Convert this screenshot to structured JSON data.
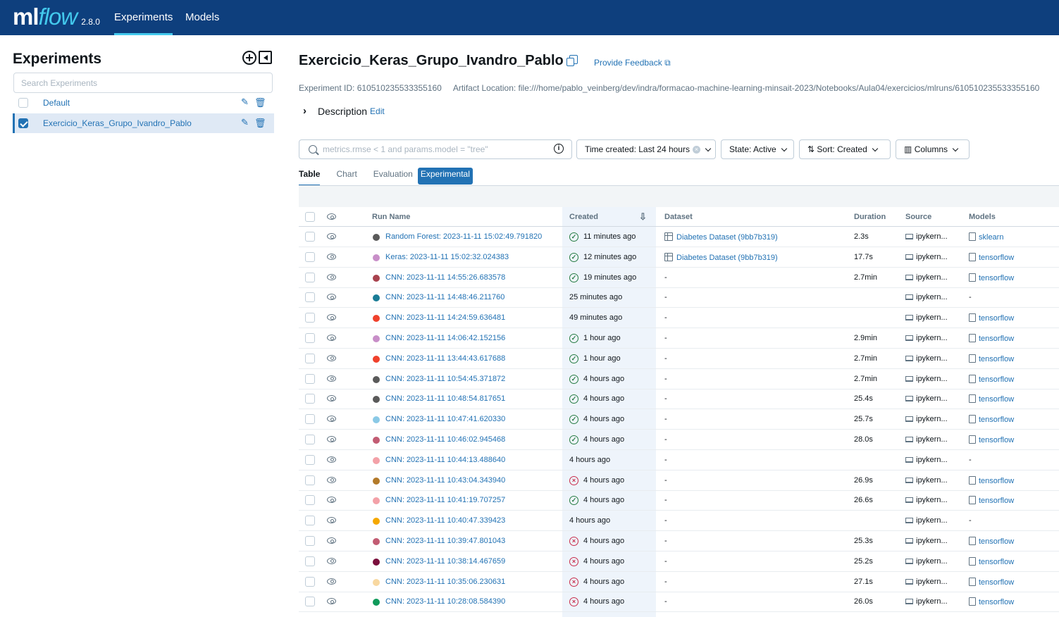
{
  "app": {
    "logo_ml": "ml",
    "logo_flow": "flow",
    "version": "2.8.0"
  },
  "nav": {
    "experiments": "Experiments",
    "models": "Models"
  },
  "sidebar": {
    "title": "Experiments",
    "search_placeholder": "Search Experiments",
    "items": [
      {
        "label": "Default",
        "selected": false
      },
      {
        "label": "Exercicio_Keras_Grupo_Ivandro_Pablo",
        "selected": true
      }
    ]
  },
  "experiment": {
    "title": "Exercicio_Keras_Grupo_Ivandro_Pablo",
    "feedback": "Provide Feedback",
    "meta": "Experiment ID: 610510235533355160     Artifact Location: file:///home/pablo_veinberg/dev/indra/formacao-machine-learning-minsait-2023/Notebooks/Aula04/exercicios/mlruns/610510235533355160",
    "description_label": "Description",
    "edit_label": "Edit"
  },
  "filters": {
    "search_placeholder": "metrics.rmse < 1 and params.model = \"tree\"",
    "time_created": "Time created: Last 24 hours",
    "state": "State: Active",
    "sort": "Sort: Created",
    "columns": "Columns"
  },
  "tabs": [
    "Table",
    "Chart",
    "Evaluation",
    "Experimental"
  ],
  "table": {
    "headers": {
      "run_name": "Run Name",
      "created": "Created",
      "dataset": "Dataset",
      "duration": "Duration",
      "source": "Source",
      "models": "Models"
    },
    "rows": [
      {
        "color": "#5a5a5a",
        "name": "Random Forest: 2023-11-11 15:02:49.791820",
        "status": "ok",
        "created": "11 minutes ago",
        "dataset": "Diabetes Dataset (9bb7b319)",
        "duration": "2.3s",
        "source": "ipykern...",
        "model": "sklearn"
      },
      {
        "color": "#c88ec8",
        "name": "Keras: 2023-11-11 15:02:32.024383",
        "status": "ok",
        "created": "12 minutes ago",
        "dataset": "Diabetes Dataset (9bb7b319)",
        "duration": "17.7s",
        "source": "ipykern...",
        "model": "tensorflow"
      },
      {
        "color": "#a8424e",
        "name": "CNN: 2023-11-11 14:55:26.683578",
        "status": "ok",
        "created": "19 minutes ago",
        "dataset": "-",
        "duration": "2.7min",
        "source": "ipykern...",
        "model": "tensorflow"
      },
      {
        "color": "#1a7c96",
        "name": "CNN: 2023-11-11 14:48:46.211760",
        "status": "none",
        "created": "25 minutes ago",
        "dataset": "-",
        "duration": "",
        "source": "ipykern...",
        "model": "-"
      },
      {
        "color": "#f0412c",
        "name": "CNN: 2023-11-11 14:24:59.636481",
        "status": "none",
        "created": "49 minutes ago",
        "dataset": "-",
        "duration": "",
        "source": "ipykern...",
        "model": "tensorflow"
      },
      {
        "color": "#c88ec8",
        "name": "CNN: 2023-11-11 14:06:42.152156",
        "status": "ok",
        "created": "1 hour ago",
        "dataset": "-",
        "duration": "2.9min",
        "source": "ipykern...",
        "model": "tensorflow"
      },
      {
        "color": "#f0412c",
        "name": "CNN: 2023-11-11 13:44:43.617688",
        "status": "ok",
        "created": "1 hour ago",
        "dataset": "-",
        "duration": "2.7min",
        "source": "ipykern...",
        "model": "tensorflow"
      },
      {
        "color": "#5a5a5a",
        "name": "CNN: 2023-11-11 10:54:45.371872",
        "status": "ok",
        "created": "4 hours ago",
        "dataset": "-",
        "duration": "2.7min",
        "source": "ipykern...",
        "model": "tensorflow"
      },
      {
        "color": "#5a5a5a",
        "name": "CNN: 2023-11-11 10:48:54.817651",
        "status": "ok",
        "created": "4 hours ago",
        "dataset": "-",
        "duration": "25.4s",
        "source": "ipykern...",
        "model": "tensorflow"
      },
      {
        "color": "#8ac9e6",
        "name": "CNN: 2023-11-11 10:47:41.620330",
        "status": "ok",
        "created": "4 hours ago",
        "dataset": "-",
        "duration": "25.7s",
        "source": "ipykern...",
        "model": "tensorflow"
      },
      {
        "color": "#c25c73",
        "name": "CNN: 2023-11-11 10:46:02.945468",
        "status": "ok",
        "created": "4 hours ago",
        "dataset": "-",
        "duration": "28.0s",
        "source": "ipykern...",
        "model": "tensorflow"
      },
      {
        "color": "#f3a1a8",
        "name": "CNN: 2023-11-11 10:44:13.488640",
        "status": "none",
        "created": "4 hours ago",
        "dataset": "-",
        "duration": "",
        "source": "ipykern...",
        "model": "-"
      },
      {
        "color": "#b37a2a",
        "name": "CNN: 2023-11-11 10:43:04.343940",
        "status": "fail",
        "created": "4 hours ago",
        "dataset": "-",
        "duration": "26.9s",
        "source": "ipykern...",
        "model": "tensorflow"
      },
      {
        "color": "#f3a1a8",
        "name": "CNN: 2023-11-11 10:41:19.707257",
        "status": "ok",
        "created": "4 hours ago",
        "dataset": "-",
        "duration": "26.6s",
        "source": "ipykern...",
        "model": "tensorflow"
      },
      {
        "color": "#f5a800",
        "name": "CNN: 2023-11-11 10:40:47.339423",
        "status": "none",
        "created": "4 hours ago",
        "dataset": "-",
        "duration": "",
        "source": "ipykern...",
        "model": "-"
      },
      {
        "color": "#c25c73",
        "name": "CNN: 2023-11-11 10:39:47.801043",
        "status": "fail",
        "created": "4 hours ago",
        "dataset": "-",
        "duration": "25.3s",
        "source": "ipykern...",
        "model": "tensorflow"
      },
      {
        "color": "#7a0f3c",
        "name": "CNN: 2023-11-11 10:38:14.467659",
        "status": "fail",
        "created": "4 hours ago",
        "dataset": "-",
        "duration": "25.2s",
        "source": "ipykern...",
        "model": "tensorflow"
      },
      {
        "color": "#f8d8a0",
        "name": "CNN: 2023-11-11 10:35:06.230631",
        "status": "fail",
        "created": "4 hours ago",
        "dataset": "-",
        "duration": "27.1s",
        "source": "ipykern...",
        "model": "tensorflow"
      },
      {
        "color": "#0f9a5a",
        "name": "CNN: 2023-11-11 10:28:08.584390",
        "status": "fail",
        "created": "4 hours ago",
        "dataset": "-",
        "duration": "26.0s",
        "source": "ipykern...",
        "model": "tensorflow"
      }
    ]
  }
}
